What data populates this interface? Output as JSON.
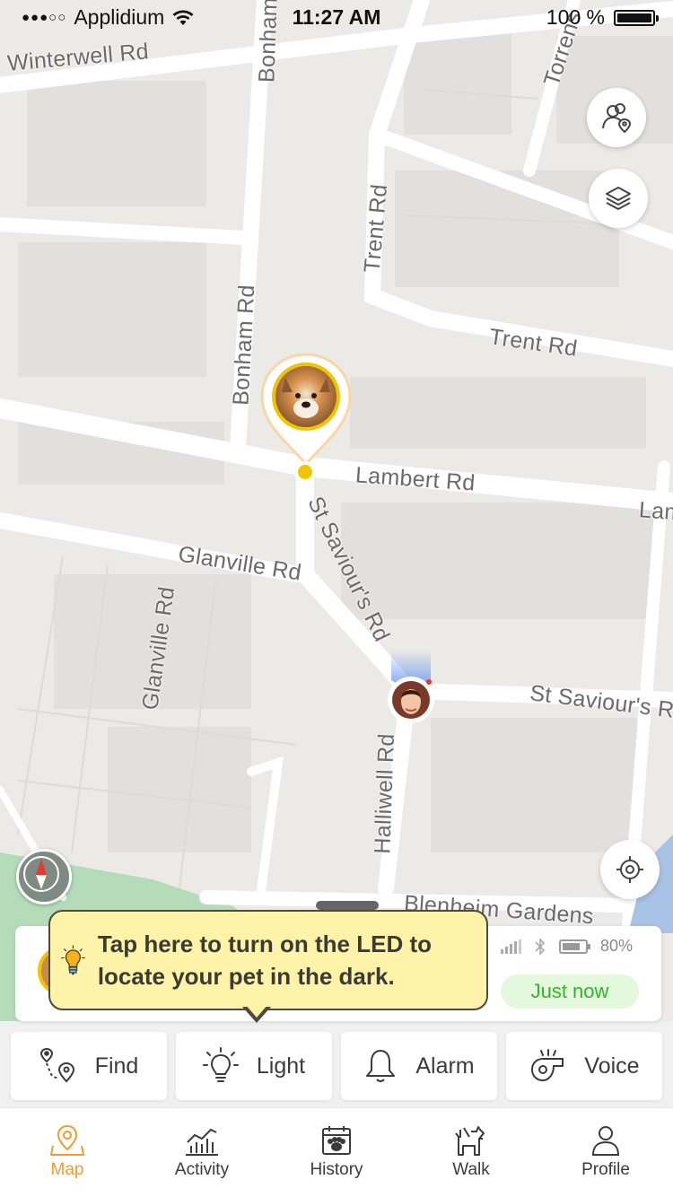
{
  "status_bar": {
    "carrier": "Applidium",
    "signal_dots": "●●●○○",
    "time": "11:27 AM",
    "battery_text": "100 %"
  },
  "map": {
    "street_labels": {
      "winterwell": "Winterwell Rd",
      "bonham_top": "Bonham",
      "bonham": "Bonham Rd",
      "torrens": "Torrens",
      "trent_vertical": "Trent Rd",
      "trent": "Trent Rd",
      "lambert": "Lambert Rd",
      "lambert_cut": "Lam",
      "glanville": "Glanville Rd",
      "glanville_vertical": "Glanville Rd",
      "st_saviours_diag": "St Saviour's Rd",
      "st_saviours": "St Saviour's R",
      "halliwell": "Halliwell Rd",
      "blenheim": "Blenheim Gardens"
    },
    "buttons": {
      "friends_icon": "people-location-icon",
      "layers_icon": "layers-icon",
      "locate_icon": "crosshair-icon",
      "compass_icon": "compass-icon"
    }
  },
  "device_card": {
    "battery_percent": "80%",
    "last_seen": "Just now"
  },
  "tooltip": {
    "text": "Tap here to turn on the LED to locate your pet in the dark."
  },
  "actions": [
    {
      "label": "Find",
      "icon": "route-pin-icon"
    },
    {
      "label": "Light",
      "icon": "lightbulb-icon"
    },
    {
      "label": "Alarm",
      "icon": "bell-icon"
    },
    {
      "label": "Voice",
      "icon": "whistle-icon"
    }
  ],
  "tabs": [
    {
      "label": "Map",
      "icon": "map-pin-icon",
      "active": true
    },
    {
      "label": "Activity",
      "icon": "activity-chart-icon",
      "active": false
    },
    {
      "label": "History",
      "icon": "calendar-paw-icon",
      "active": false
    },
    {
      "label": "Walk",
      "icon": "dog-icon",
      "active": false
    },
    {
      "label": "Profile",
      "icon": "person-icon",
      "active": false
    }
  ],
  "colors": {
    "accent": "#f59a2c",
    "pet_ring": "#f2c400",
    "tooltip_bg": "#fef3a8",
    "online_green": "#33b52a",
    "park_green": "#b5dcb8"
  }
}
